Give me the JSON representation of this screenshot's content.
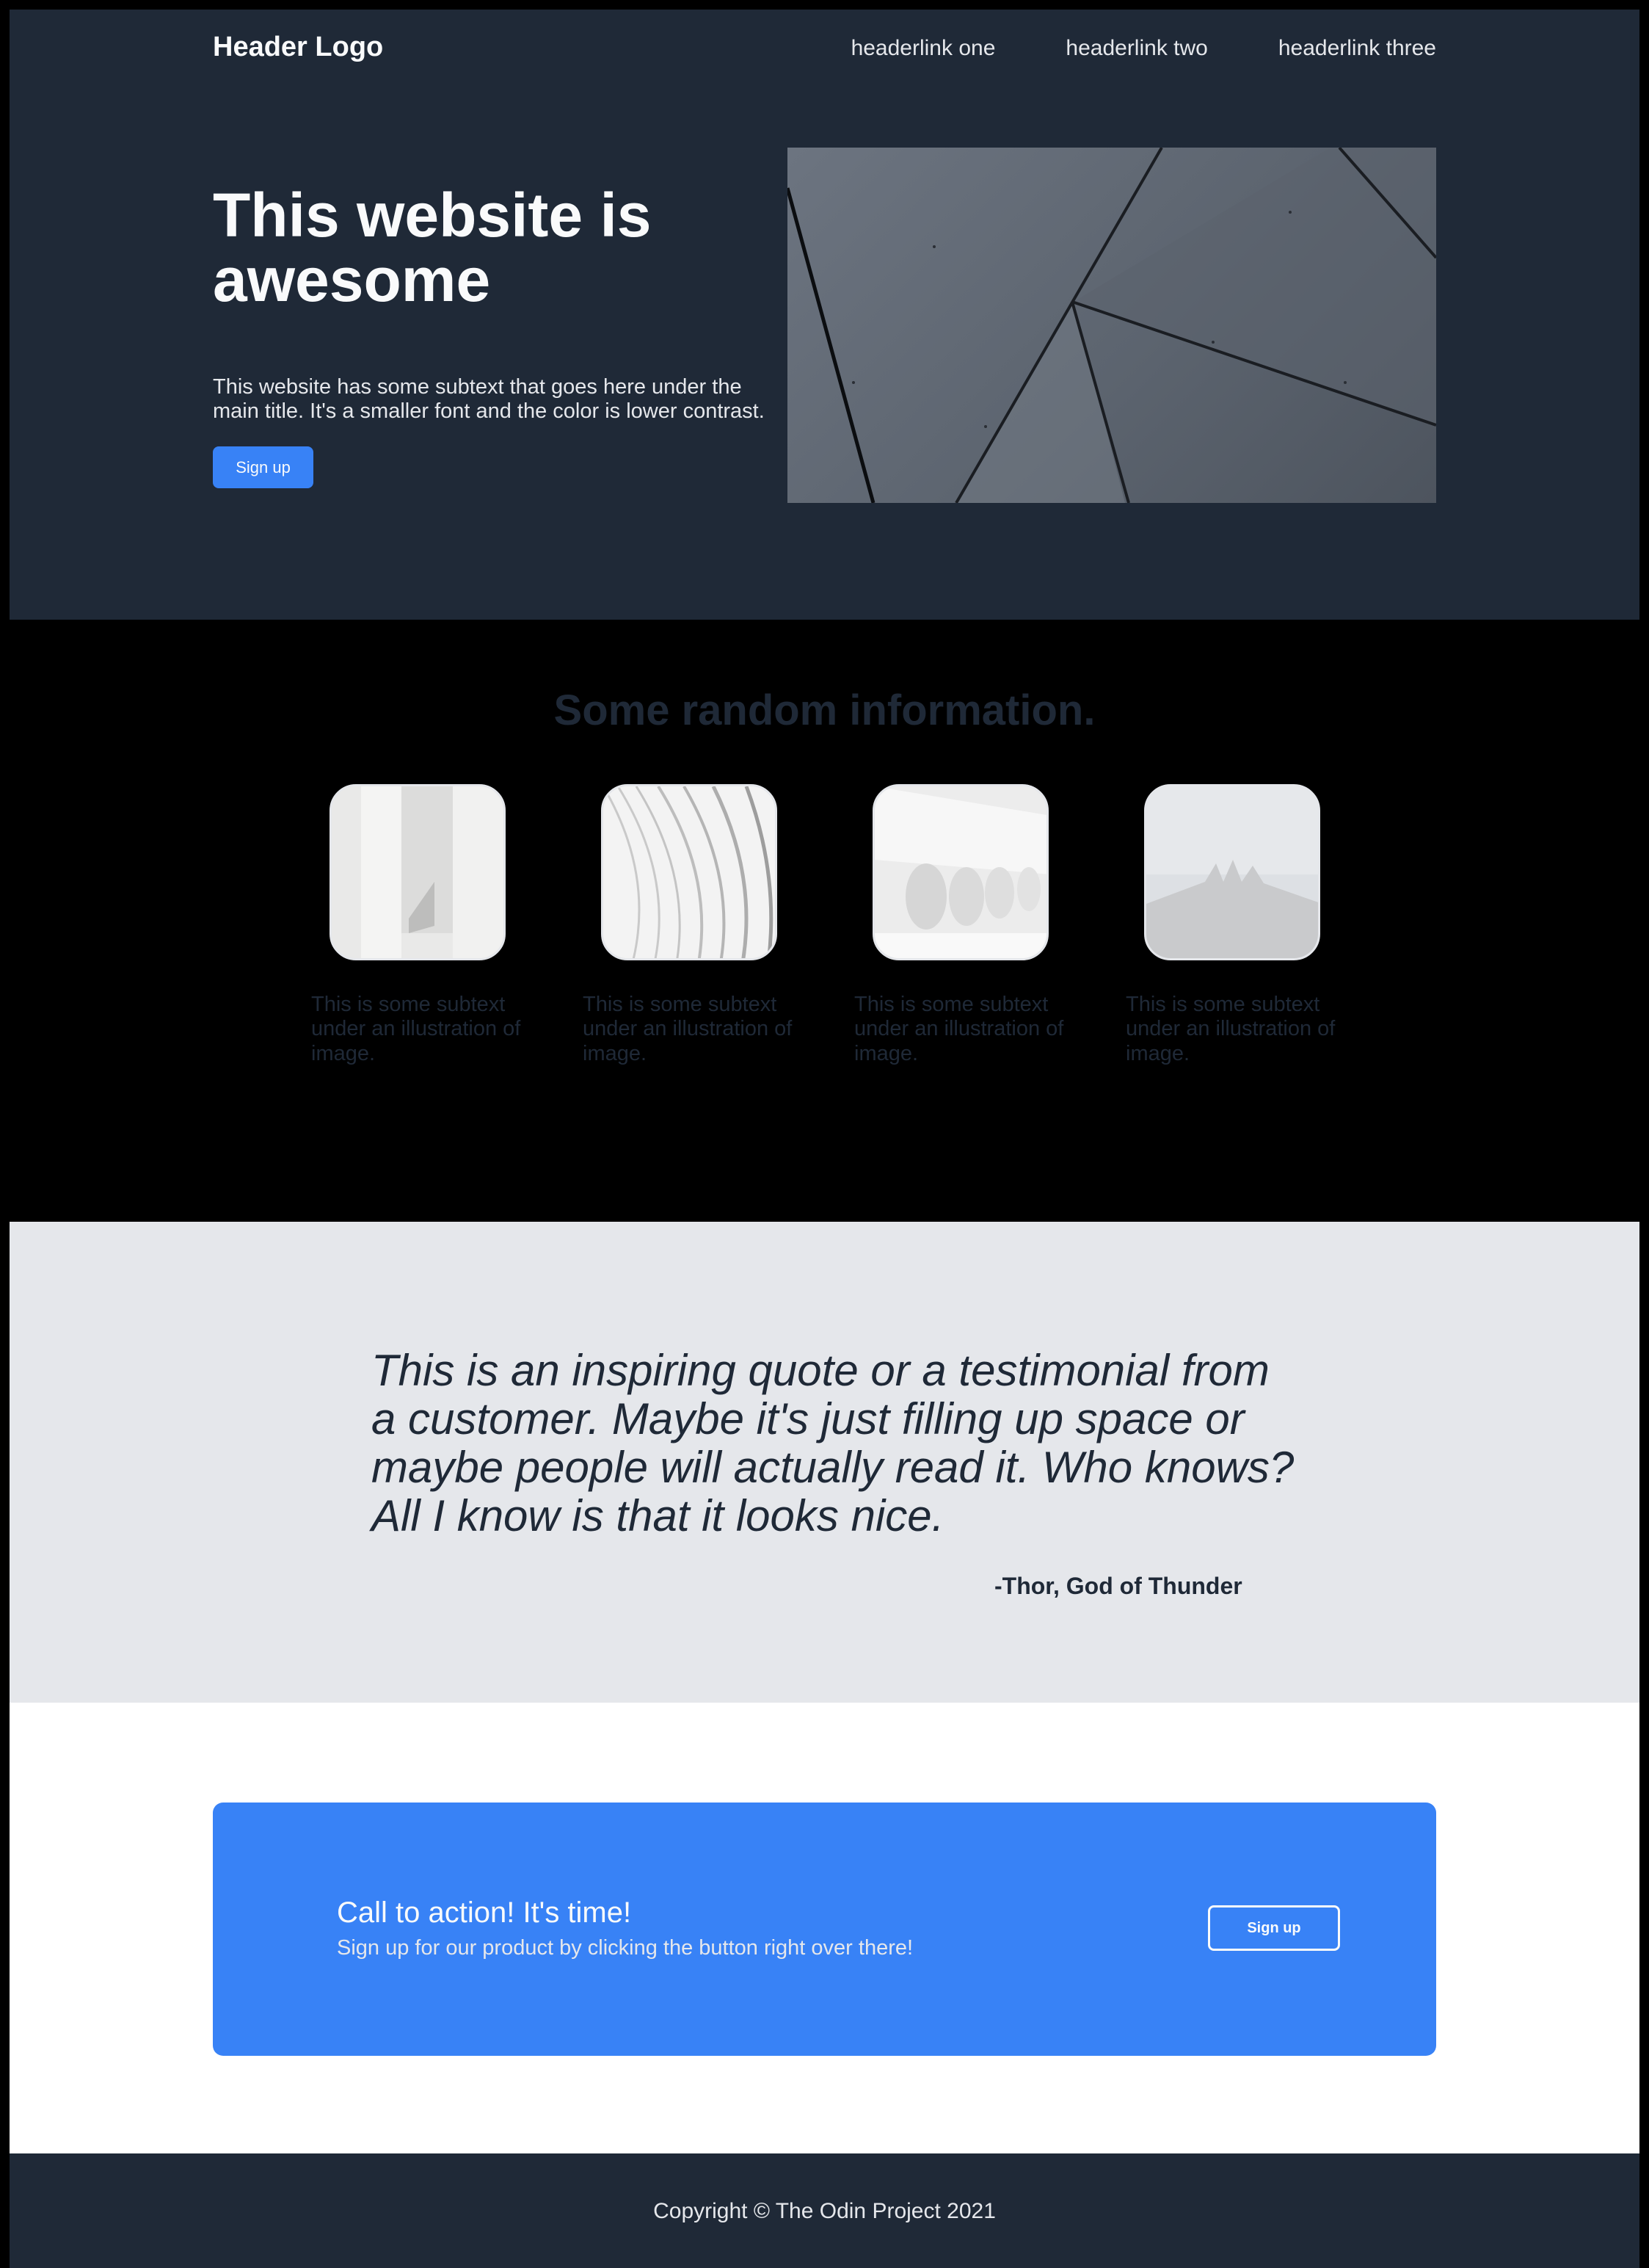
{
  "header": {
    "logo": "Header Logo",
    "links": [
      "headerlink one",
      "headerlink two",
      "headerlink three"
    ]
  },
  "hero": {
    "title": "This website is awesome",
    "subtext": "This website has some subtext that goes here under the main title. It's a smaller font and the color is lower contrast.",
    "button_label": "Sign up"
  },
  "info": {
    "title": "Some random information.",
    "cards": [
      {
        "text": "This is some subtext under an illustration of image."
      },
      {
        "text": "This is some subtext under an illustration of image."
      },
      {
        "text": "This is some subtext under an illustration of image."
      },
      {
        "text": "This is some subtext under an illustration of image."
      }
    ]
  },
  "quote": {
    "text": "This is an inspiring quote or a testimonial from a customer. Maybe it's just filling up space or maybe people will actually read it. Who knows? All I know is that it looks nice.",
    "author": "-Thor, God of Thunder"
  },
  "cta": {
    "title": "Call to action! It's time!",
    "subtext": "Sign up for our product by clicking the button right over there!",
    "button_label": "Sign up"
  },
  "footer": {
    "copyright": "Copyright © The Odin Project 2021"
  },
  "colors": {
    "dark": "#1f2937",
    "accent": "#3882f6",
    "light": "#e5e7eb",
    "white": "#f9fafb"
  }
}
